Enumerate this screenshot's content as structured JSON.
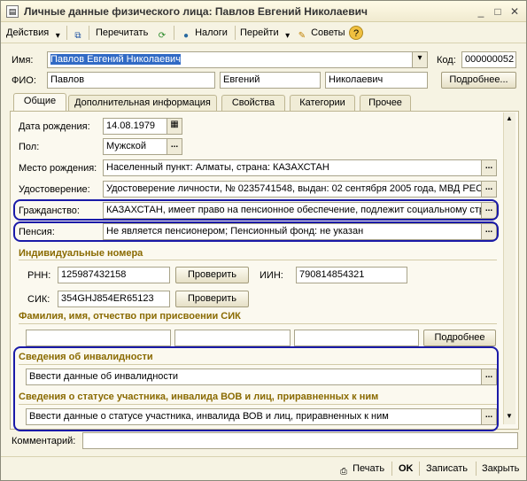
{
  "window": {
    "title": "Личные данные физического лица: Павлов Евгений Николаевич",
    "minimize": "_",
    "maximize": "□",
    "close": "✕"
  },
  "toolbar": {
    "actions": "Действия",
    "reread": "Перечитать",
    "taxes": "Налоги",
    "goto": "Перейти",
    "tips": "Советы",
    "help": "?"
  },
  "header": {
    "name_label": "Имя:",
    "name_value": "Павлов Евгений Николаевич",
    "code_label": "Код:",
    "code_value": "000000052",
    "fio_label": "ФИО:",
    "last_name": "Павлов",
    "first_name": "Евгений",
    "middle_name": "Николаевич",
    "details_button": "Подробнее..."
  },
  "tabs": [
    {
      "label": "Общие"
    },
    {
      "label": "Дополнительная информация"
    },
    {
      "label": "Свойства"
    },
    {
      "label": "Категории"
    },
    {
      "label": "Прочее"
    }
  ],
  "general": {
    "birth_date_label": "Дата рождения:",
    "birth_date_value": "14.08.1979",
    "sex_label": "Пол:",
    "sex_value": "Мужской",
    "birthplace_label": "Место рождения:",
    "birthplace_value": "Населенный пункт: Алматы, страна: КАЗАХСТАН",
    "id_label": "Удостоверение:",
    "id_value": "Удостоверение личности, № 0235741548, выдан: 02 сентября 2005 года, МВД РЕС",
    "citizenship_label": "Гражданство:",
    "citizenship_value": "КАЗАХСТАН, имеет право на пенсионное обеспечение, подлежит социальному стр",
    "pension_label": "Пенсия:",
    "pension_value": "Не является пенсионером; Пенсионный фонд: не указан"
  },
  "individual_numbers": {
    "title": "Индивидуальные номера",
    "rnn_label": "РНН:",
    "rnn_value": "125987432158",
    "check_button": "Проверить",
    "iin_label": "ИИН:",
    "iin_value": "790814854321",
    "sik_label": "СИК:",
    "sik_value": "354GHJ854ER65123",
    "check_button_2": "Проверить"
  },
  "sik_fio": {
    "title": "Фамилия, имя, отчество при присвоении СИК",
    "details_button": "Подробнее"
  },
  "disability": {
    "title": "Сведения об инвалидности",
    "value": "Ввести данные об инвалидности"
  },
  "wwii": {
    "title": "Сведения о статусе участника, инвалида ВОВ и лиц, приравненных к ним",
    "value": "Ввести данные о статусе участника, инвалида ВОВ и лиц, приравненных к ним"
  },
  "comment": {
    "label": "Комментарий:",
    "value": ""
  },
  "bottom": {
    "print": "Печать",
    "ok": "OK",
    "save": "Записать",
    "close": "Закрыть"
  },
  "dots": "...",
  "colors": {
    "highlight_oval": "#1a1aa8",
    "section_title": "#8a6a00",
    "selection": "#316ac5"
  }
}
